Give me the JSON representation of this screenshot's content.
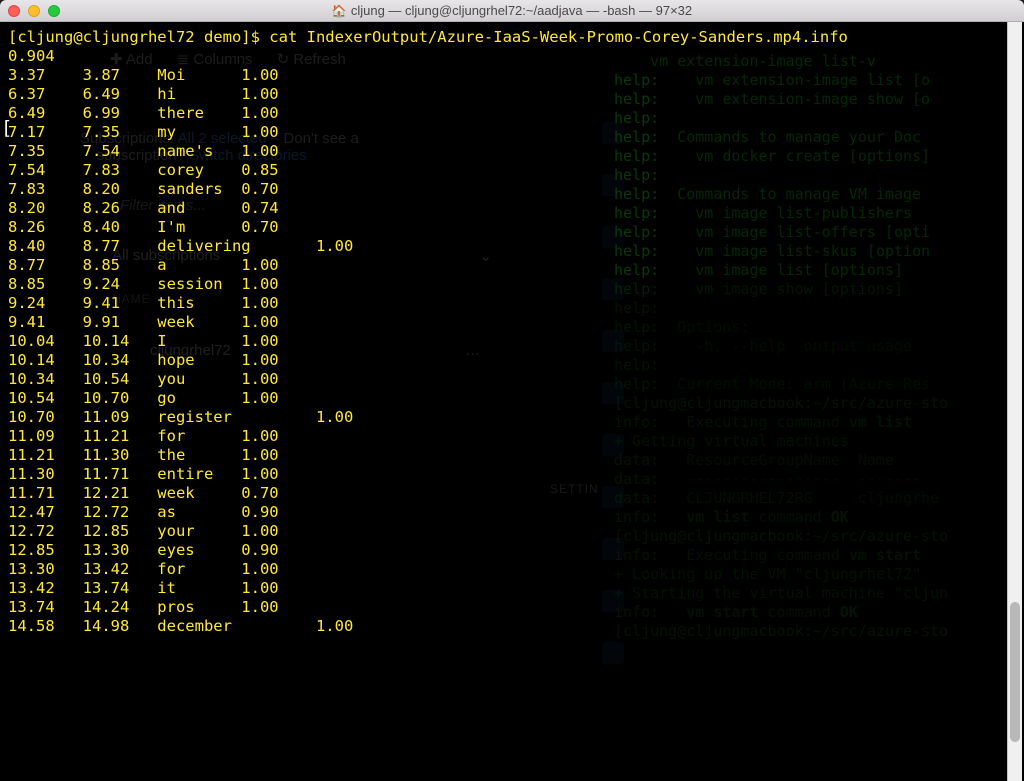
{
  "window": {
    "title": "cljung — cljung@cljungrhel72:~/aadjava — -bash — 97×32"
  },
  "prompt": "[cljung@cljungrhel72 demo]$ ",
  "command": "cat IndexerOutput/Azure-IaaS-Week-Promo-Corey-Sanders.mp4.info",
  "first_value": "0.904",
  "rows": [
    {
      "s": "3.37",
      "e": "3.87",
      "w": "Moi",
      "c": "1.00",
      "far": false
    },
    {
      "s": "6.37",
      "e": "6.49",
      "w": "hi",
      "c": "1.00",
      "far": false
    },
    {
      "s": "6.49",
      "e": "6.99",
      "w": "there",
      "c": "1.00",
      "far": false
    },
    {
      "s": "7.17",
      "e": "7.35",
      "w": "my",
      "c": "1.00",
      "far": false
    },
    {
      "s": "7.35",
      "e": "7.54",
      "w": "name's",
      "c": "1.00",
      "far": false
    },
    {
      "s": "7.54",
      "e": "7.83",
      "w": "corey",
      "c": "0.85",
      "far": false
    },
    {
      "s": "7.83",
      "e": "8.20",
      "w": "sanders",
      "c": "0.70",
      "far": false
    },
    {
      "s": "8.20",
      "e": "8.26",
      "w": "and",
      "c": "0.74",
      "far": false
    },
    {
      "s": "8.26",
      "e": "8.40",
      "w": "I'm",
      "c": "0.70",
      "far": false
    },
    {
      "s": "8.40",
      "e": "8.77",
      "w": "delivering",
      "c": "1.00",
      "far": true
    },
    {
      "s": "8.77",
      "e": "8.85",
      "w": "a",
      "c": "1.00",
      "far": false
    },
    {
      "s": "8.85",
      "e": "9.24",
      "w": "session",
      "c": "1.00",
      "far": false
    },
    {
      "s": "9.24",
      "e": "9.41",
      "w": "this",
      "c": "1.00",
      "far": false
    },
    {
      "s": "9.41",
      "e": "9.91",
      "w": "week",
      "c": "1.00",
      "far": false
    },
    {
      "s": "10.04",
      "e": "10.14",
      "w": "I",
      "c": "1.00",
      "far": false
    },
    {
      "s": "10.14",
      "e": "10.34",
      "w": "hope",
      "c": "1.00",
      "far": false
    },
    {
      "s": "10.34",
      "e": "10.54",
      "w": "you",
      "c": "1.00",
      "far": false
    },
    {
      "s": "10.54",
      "e": "10.70",
      "w": "go",
      "c": "1.00",
      "far": false
    },
    {
      "s": "10.70",
      "e": "11.09",
      "w": "register",
      "c": "1.00",
      "far": true
    },
    {
      "s": "11.09",
      "e": "11.21",
      "w": "for",
      "c": "1.00",
      "far": false
    },
    {
      "s": "11.21",
      "e": "11.30",
      "w": "the",
      "c": "1.00",
      "far": false
    },
    {
      "s": "11.30",
      "e": "11.71",
      "w": "entire",
      "c": "1.00",
      "far": false
    },
    {
      "s": "11.71",
      "e": "12.21",
      "w": "week",
      "c": "0.70",
      "far": false
    },
    {
      "s": "12.47",
      "e": "12.72",
      "w": "as",
      "c": "0.90",
      "far": false
    },
    {
      "s": "12.72",
      "e": "12.85",
      "w": "your",
      "c": "1.00",
      "far": false
    },
    {
      "s": "12.85",
      "e": "13.30",
      "w": "eyes",
      "c": "0.90",
      "far": false
    },
    {
      "s": "13.30",
      "e": "13.42",
      "w": "for",
      "c": "1.00",
      "far": false
    },
    {
      "s": "13.42",
      "e": "13.74",
      "w": "it",
      "c": "1.00",
      "far": false
    },
    {
      "s": "13.74",
      "e": "14.24",
      "w": "pros",
      "c": "1.00",
      "far": false
    },
    {
      "s": "14.58",
      "e": "14.98",
      "w": "december",
      "c": "1.00",
      "far": true
    }
  ],
  "bg_right_lines": [
    {
      "text": "    vm extension-image list-v",
      "style": "cmd"
    },
    {
      "lbl": "help:",
      "text": "    vm extension-image list [o",
      "style": "cmd"
    },
    {
      "lbl": "help:",
      "text": "    vm extension-image show [o",
      "style": "cmd"
    },
    {
      "lbl": "help:",
      "text": "",
      "style": "cmd"
    },
    {
      "lbl": "help:",
      "text": "  Commands to manage your Doc",
      "style": "cmd"
    },
    {
      "lbl": "help:",
      "text": "    vm docker create [options]",
      "style": "cmd"
    },
    {
      "lbl": "help:",
      "text": "",
      "style": "cmd"
    },
    {
      "lbl": "help:",
      "text": "  Commands to manage VM image",
      "style": "cmd"
    },
    {
      "lbl": "help:",
      "text": "    vm image list-publishers  ",
      "style": "cmd"
    },
    {
      "lbl": "help:",
      "text": "    vm image list-offers [opti",
      "style": "cmd"
    },
    {
      "lbl": "help:",
      "text": "    vm image list-skus [option",
      "style": "cmd"
    },
    {
      "lbl": "help:",
      "text": "    vm image list [options] <l",
      "style": "cmd"
    },
    {
      "lbl": "help:",
      "text": "    vm image show [options] <l",
      "style": "cmd"
    },
    {
      "lbl": "help:",
      "text": "",
      "style": "cmd"
    },
    {
      "lbl": "help:",
      "text": "  Options:",
      "style": "cmd"
    },
    {
      "lbl": "help:",
      "text": "    -h, --help  output usage  ",
      "style": "cmd"
    },
    {
      "lbl": "help:",
      "text": "",
      "style": "cmd"
    },
    {
      "lbl": "help:",
      "text": "  Current Mode: arm (Azure Res",
      "style": "cmd"
    },
    {
      "prompt": "[cljung@cljungmacbook:",
      "path": "~/src/azure-sto"
    },
    {
      "lbl": "info:",
      "text": "   Executing command ",
      "bold": "vm list",
      "style": "info"
    },
    {
      "text": "+ Getting virtual machines",
      "style": "info"
    },
    {
      "lbl": "data:",
      "text": "   ResourceGroupName  Name   ",
      "style": "data"
    },
    {
      "lbl": "data:",
      "text": "   -----------------  -------",
      "style": "data"
    },
    {
      "lbl": "data:",
      "text": "   CLJUNGRHEL72RG     cljungrhe",
      "style": "data"
    },
    {
      "lbl": "info:",
      "text": "   ",
      "bold": "vm list",
      " tail": " command ",
      "ok": "OK",
      "style": "info"
    },
    {
      "prompt": "[cljung@cljungmacbook:",
      "path": "~/src/azure-sto"
    },
    {
      "lbl": "info:",
      "text": "   Executing command ",
      "bold": "vm start",
      "style": "info"
    },
    {
      "text": "+ Looking up the VM \"cljungrhel72\"",
      "style": "info"
    },
    {
      "text": "+ Starting the virtual machine \"cljun",
      "style": "info"
    },
    {
      "lbl": "info:",
      "text": "   ",
      "bold": "vm start",
      " tail": " command ",
      "ok": "OK",
      "style": "info"
    },
    {
      "prompt": "[cljung@cljungmacbook:",
      "path": "~/src/azure-sto"
    }
  ],
  "bg_ui": {
    "toolbar": {
      "add": "Add",
      "columns": "Columns",
      "refresh": "Refresh"
    },
    "subs1": "Subscriptions:",
    "subs_link": "All 2 selected",
    "subs2": " – Don't see a",
    "subs3": "subscription?",
    "subs_switch": "Switch directories",
    "filter": "Filter items...",
    "allsubs": "All subscriptions",
    "rowitem": "cljungrhel72",
    "dots": "…",
    "settings": "SETTIN",
    "name_hdr": "NAME"
  }
}
